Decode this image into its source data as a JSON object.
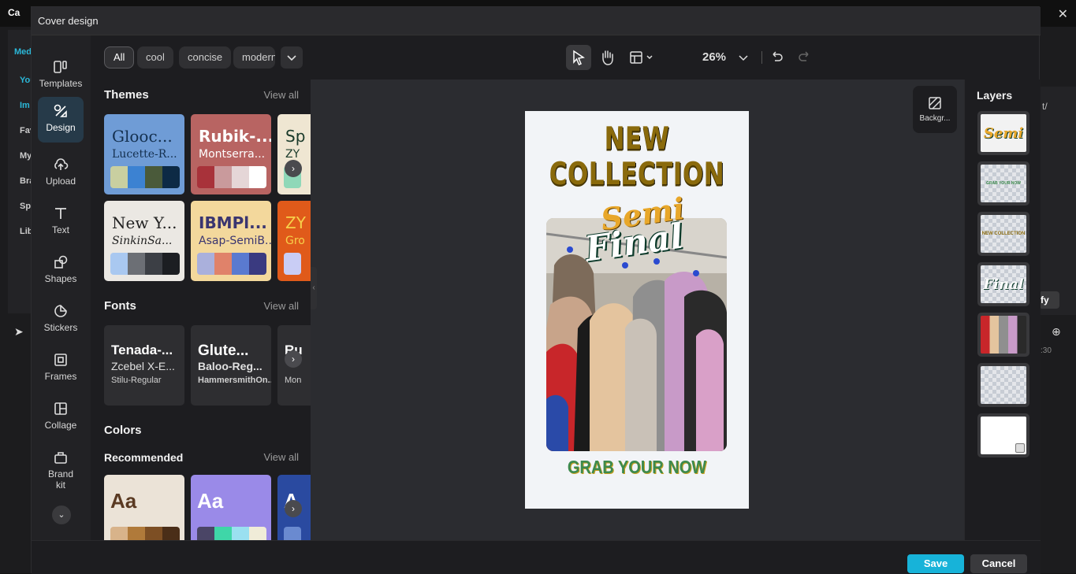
{
  "modal": {
    "title": "Cover design"
  },
  "toolrail": [
    {
      "label": "Templates",
      "icon": "templates-icon"
    },
    {
      "label": "Design",
      "icon": "design-icon"
    },
    {
      "label": "Upload",
      "icon": "upload-icon"
    },
    {
      "label": "Text",
      "icon": "text-icon"
    },
    {
      "label": "Shapes",
      "icon": "shapes-icon"
    },
    {
      "label": "Stickers",
      "icon": "stickers-icon"
    },
    {
      "label": "Frames",
      "icon": "frames-icon"
    },
    {
      "label": "Collage",
      "icon": "collage-icon"
    },
    {
      "label": "Brand kit",
      "icon": "brand-kit-icon"
    }
  ],
  "filters": [
    "All",
    "cool",
    "concise",
    "modern"
  ],
  "themes": {
    "title": "Themes",
    "view_all": "View all",
    "cards": [
      {
        "name": "Glooc...",
        "sub": "Lucette-R...",
        "bg": "#6f9cd6",
        "fg": "#14304f",
        "colors": [
          "#c9cfa0",
          "#3c82d2",
          "#4a5a3a",
          "#0d2a45"
        ]
      },
      {
        "name": "Rubik-...",
        "sub": "Montserra...",
        "bg": "#b86462",
        "fg": "#ffffff",
        "colors": [
          "#a8323a",
          "#c99a9c",
          "#e5d6d7",
          "#ffffff"
        ]
      },
      {
        "name": "Sp",
        "sub": "ZY",
        "bg": "#efe6d2",
        "fg": "#1a3a2a",
        "colors": [
          "#8fd8b8"
        ]
      },
      {
        "name": "New Y...",
        "sub": "SinkinSa...",
        "bg": "#ebe8e3",
        "fg": "#222222",
        "colors": [
          "#a9c8f0",
          "#6c6f75",
          "#3c3f45",
          "#1c1e22"
        ]
      },
      {
        "name": "IBMPl...",
        "sub": "Asap-SemiB...",
        "bg": "#f3d89c",
        "fg": "#3a3570",
        "colors": [
          "#aab0dc",
          "#e0826a",
          "#5a7ad0",
          "#3a3a80"
        ]
      },
      {
        "name": "ZY",
        "sub": "Gro",
        "bg": "#e05a1a",
        "fg": "#f7d04a",
        "colors": [
          "#c9cdf5"
        ]
      }
    ]
  },
  "fonts": {
    "title": "Fonts",
    "view_all": "View all",
    "cards": [
      {
        "l1": "Tenada-...",
        "l2": "Zcebel X-E...",
        "l3": "Stilu-Regular"
      },
      {
        "l1": "Glute...",
        "l2": "Baloo-Reg...",
        "l3": "HammersmithOn..."
      },
      {
        "l1": "Ru",
        "l2": "",
        "l3": "Mon"
      }
    ]
  },
  "colors": {
    "title": "Colors",
    "recommended": "Recommended",
    "view_all": "View all",
    "cards": [
      {
        "aa": "Aa",
        "bg": "#ebe3d7",
        "fg": "#5a3a22",
        "colors": [
          "#d8b38a",
          "#b07a3a",
          "#7d4f24",
          "#4a2e18"
        ]
      },
      {
        "aa": "Aa",
        "bg": "#9a8ae8",
        "fg": "#ffffff",
        "colors": [
          "#4a4566",
          "#3fd6a8",
          "#9ae0f0",
          "#f0ecd8"
        ]
      },
      {
        "aa": "A",
        "bg": "#2a4aa0",
        "fg": "#ffffff",
        "colors": [
          "#6a8ad0"
        ]
      }
    ]
  },
  "toolbar": {
    "zoom": "26%"
  },
  "background_btn": {
    "label": "Backgr..."
  },
  "poster": {
    "title": "NEW COLLECTION",
    "semi": "Semi",
    "final": "Final",
    "cta": "GRAB YOUR NOW"
  },
  "layers": {
    "title": "Layers",
    "items": [
      {
        "label": "Semi",
        "color": "#e8a72a",
        "size": "18px",
        "italic": true,
        "bg": "#f2f2f2"
      },
      {
        "label": "GRAB YOUR NOW",
        "color": "#3d8a4d",
        "size": "5px",
        "italic": false,
        "bg": ""
      },
      {
        "label": "NEW COLLECTION",
        "color": "#8a6a0c",
        "size": "6px",
        "italic": false,
        "bg": ""
      },
      {
        "label": "Final",
        "color": "#ffffff",
        "size": "18px",
        "italic": true,
        "bg": ""
      },
      {
        "label": "",
        "color": "",
        "size": "",
        "italic": false,
        "bg": "photo"
      },
      {
        "label": "",
        "color": "",
        "size": "",
        "italic": false,
        "bg": ""
      },
      {
        "label": "",
        "color": "",
        "size": "",
        "italic": false,
        "bg": "#ffffff"
      }
    ]
  },
  "footer": {
    "save": "Save",
    "cancel": "Cancel"
  },
  "background_app": {
    "logo": "Ca",
    "left_nav": [
      "Med",
      "You",
      "Im",
      "Fav",
      "My",
      "Bra",
      "Sp",
      "Lib"
    ],
    "right_texts": [
      "t/",
      "fy",
      ":30"
    ]
  }
}
